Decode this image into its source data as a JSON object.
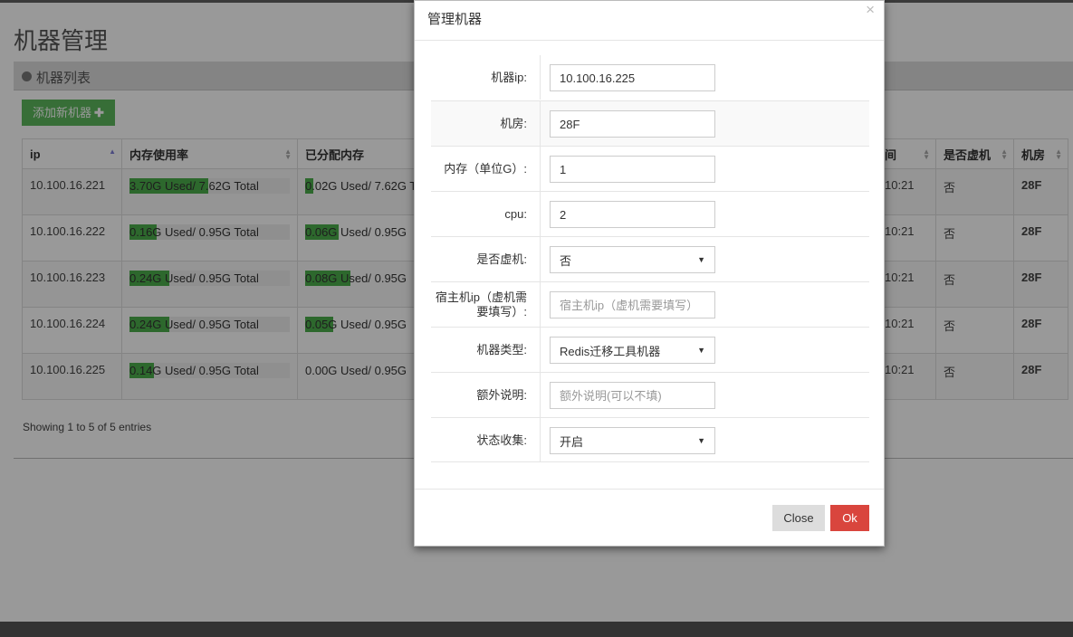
{
  "page": {
    "title": "机器管理",
    "box_title": "机器列表",
    "add_button": "添加新机器",
    "footer_info": "Showing 1 to 5 of 5 entries"
  },
  "table": {
    "columns": [
      {
        "label": "ip",
        "sort": "asc"
      },
      {
        "label": "内存使用率",
        "sort": "both"
      },
      {
        "label": "已分配内存",
        "sort": "both"
      },
      {
        "label": "间",
        "sort": "both"
      },
      {
        "label": "是否虚机",
        "sort": "both"
      },
      {
        "label": "机房",
        "sort": "both"
      }
    ],
    "rows": [
      {
        "ip": "10.100.16.221",
        "mem_used": "3.70G  Used/ 7.62G  Total",
        "mem_pct": 0.49,
        "alloc": "0.02G  Used/ 7.62G  T",
        "alloc_pct": 0.01,
        "time": "10:21",
        "virtual": "否",
        "room": "28F"
      },
      {
        "ip": "10.100.16.222",
        "mem_used": "0.16G  Used/ 0.95G  Total",
        "mem_pct": 0.17,
        "alloc": "0.06G  Used/ 0.95G",
        "alloc_pct": 0.06,
        "time": "10:21",
        "virtual": "否",
        "room": "28F"
      },
      {
        "ip": "10.100.16.223",
        "mem_used": "0.24G  Used/ 0.95G  Total",
        "mem_pct": 0.25,
        "alloc": "0.08G  Used/ 0.95G",
        "alloc_pct": 0.08,
        "time": "10:21",
        "virtual": "否",
        "room": "28F"
      },
      {
        "ip": "10.100.16.224",
        "mem_used": "0.24G  Used/ 0.95G  Total",
        "mem_pct": 0.25,
        "alloc": "0.05G  Used/ 0.95G",
        "alloc_pct": 0.05,
        "time": "10:21",
        "virtual": "否",
        "room": "28F"
      },
      {
        "ip": "10.100.16.225",
        "mem_used": "0.14G  Used/ 0.95G  Total",
        "mem_pct": 0.15,
        "alloc": "0.00G  Used/ 0.95G",
        "alloc_pct": 0.0,
        "time": "10:21",
        "virtual": "否",
        "room": "28F"
      }
    ]
  },
  "modal": {
    "title": "管理机器",
    "close_icon": "×",
    "fields": {
      "ip": {
        "label": "机器ip:",
        "value": "10.100.16.225"
      },
      "room": {
        "label": "机房:",
        "value": "28F"
      },
      "memory": {
        "label": "内存（单位G）:",
        "value": "1"
      },
      "cpu": {
        "label": "cpu:",
        "value": "2"
      },
      "virtual": {
        "label": "是否虚机:",
        "value": "否"
      },
      "host_ip": {
        "label": "宿主机ip（虚机需要填写）:",
        "placeholder": "宿主机ip（虚机需要填写）"
      },
      "type": {
        "label": "机器类型:",
        "value": "Redis迁移工具机器"
      },
      "extra": {
        "label": "额外说明:",
        "placeholder": "额外说明(可以不填)"
      },
      "collect": {
        "label": "状态收集:",
        "value": "开启"
      }
    },
    "close_button": "Close",
    "ok_button": "Ok"
  },
  "colors": {
    "accent_green": "#5cb85c",
    "ok_red": "#d9453d",
    "ip_link": "#3a6ea5"
  }
}
